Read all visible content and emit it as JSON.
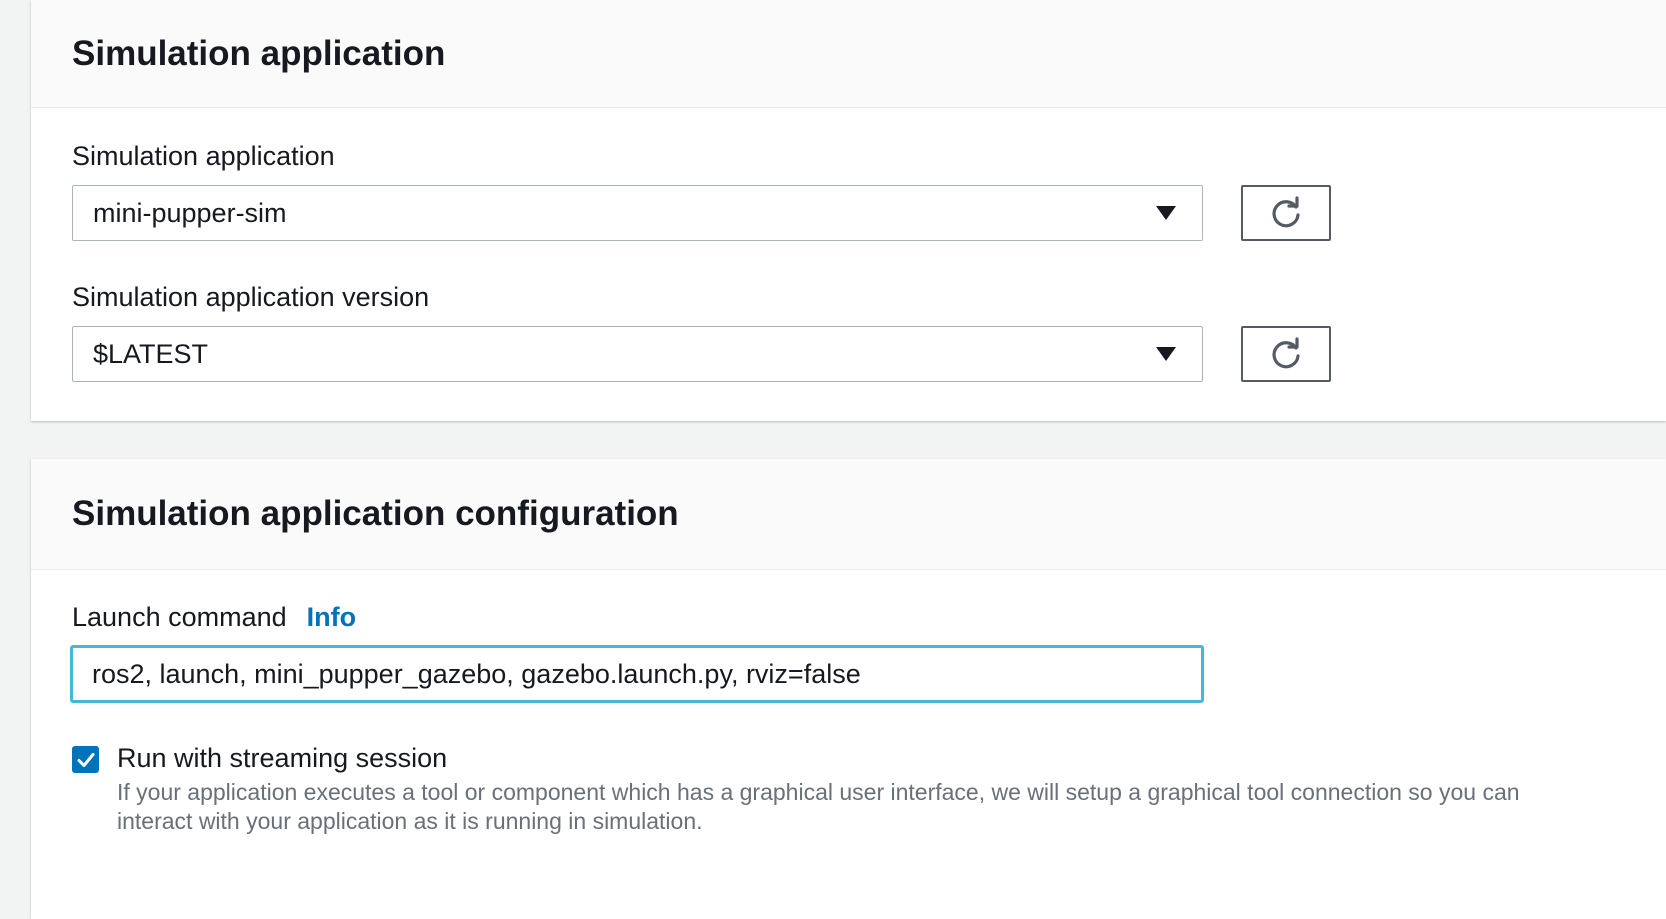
{
  "panel1": {
    "title": "Simulation application",
    "app_label": "Simulation application",
    "app_value": "mini-pupper-sim",
    "version_label": "Simulation application version",
    "version_value": "$LATEST"
  },
  "panel2": {
    "title": "Simulation application configuration",
    "launch_label": "Launch command",
    "info_link": "Info",
    "launch_value": "ros2, launch, mini_pupper_gazebo, gazebo.launch.py, rviz=false",
    "streaming_checked": true,
    "streaming_label": "Run with streaming session",
    "streaming_desc": "If your application executes a tool or component which has a graphical user interface, we will setup a graphical tool connection so you can interact with your application as it is running in simulation."
  },
  "colors": {
    "accent": "#0073bb",
    "focus_border": "#44b9d6",
    "page_bg": "#f2f3f3"
  },
  "icons": {
    "refresh": "refresh-icon",
    "caret": "caret-down-icon",
    "check": "check-icon"
  }
}
